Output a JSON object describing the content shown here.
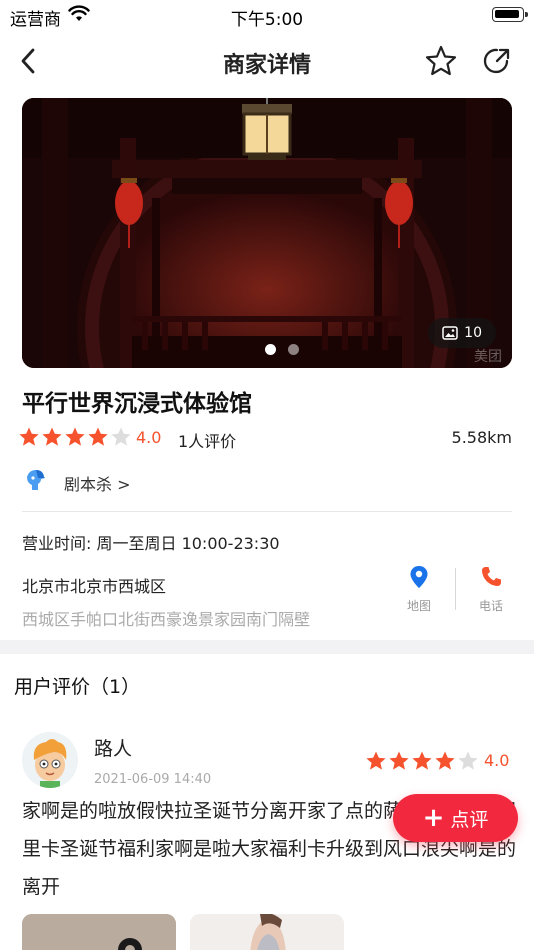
{
  "status_bar": {
    "carrier": "运营商",
    "time": "下午5:00"
  },
  "nav": {
    "title": "商家详情"
  },
  "banner": {
    "image_count": "10",
    "watermark": "美团",
    "dots_total": 2,
    "dots_active": 0
  },
  "shop": {
    "name": "平行世界沉浸式体验馆",
    "rating": 4.0,
    "score_text": "4.0",
    "review_count": "1人评价",
    "distance": "5.58km",
    "category": "剧本杀 >",
    "hours": "营业时间: 周一至周日 10:00-23:30",
    "address_city": "北京市北京市西城区",
    "address_detail": "西城区手帕口北街西豪逸景家园南门隔壁",
    "map_label": "地图",
    "phone_label": "电话"
  },
  "reviews_section": {
    "title": "用户评价（1）",
    "items": [
      {
        "user": "路人",
        "date": "2021-06-09 14:40",
        "rating": 4.0,
        "score_text": "4.0",
        "text": "家啊是的啦放假快拉圣诞节分离开家了点的萨卡扇区开房间里卡圣诞节福利家啊是啦大家福利卡升级到风口浪尖啊是的离开"
      }
    ]
  },
  "fab": {
    "label": "点评"
  },
  "colors": {
    "accent": "#f5522d",
    "fab": "#f2283f",
    "map_icon": "#1a73e8",
    "phone_icon": "#f5522d"
  }
}
